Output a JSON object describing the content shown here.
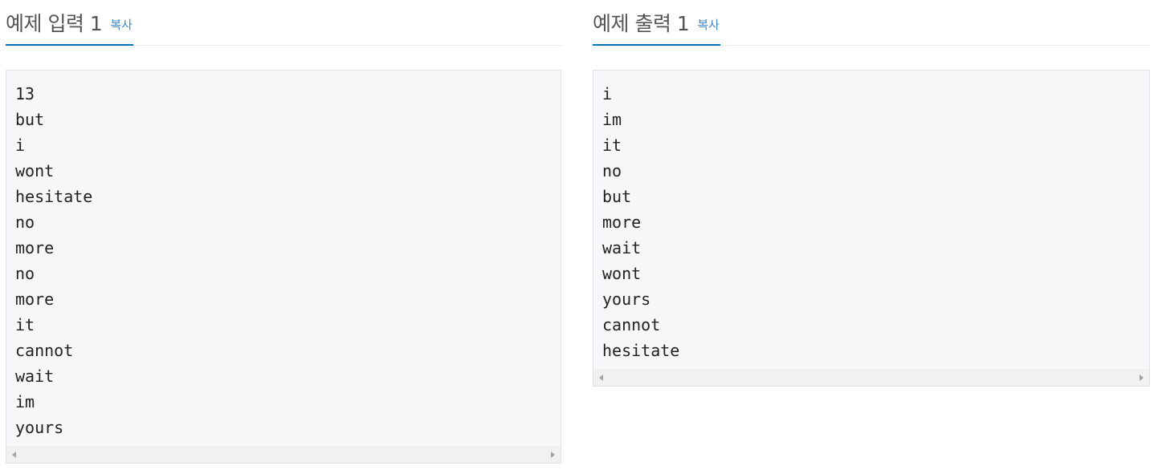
{
  "input": {
    "title": "예제 입력 1",
    "copy_label": "복사",
    "lines": [
      "13",
      "but",
      "i",
      "wont",
      "hesitate",
      "no",
      "more",
      "no",
      "more",
      "it",
      "cannot",
      "wait",
      "im",
      "yours"
    ]
  },
  "output": {
    "title": "예제 출력 1",
    "copy_label": "복사",
    "lines": [
      "i",
      "im",
      "it",
      "no",
      "but",
      "more",
      "wait",
      "wont",
      "yours",
      "cannot",
      "hesitate"
    ]
  },
  "colors": {
    "accent_underline": "#0076c0",
    "link": "#428bca",
    "box_background": "#f7f7f9",
    "box_border": "#e1e1e8"
  },
  "icons": {
    "scroll_left": "scroll-left-arrow-icon",
    "scroll_right": "scroll-right-arrow-icon"
  }
}
